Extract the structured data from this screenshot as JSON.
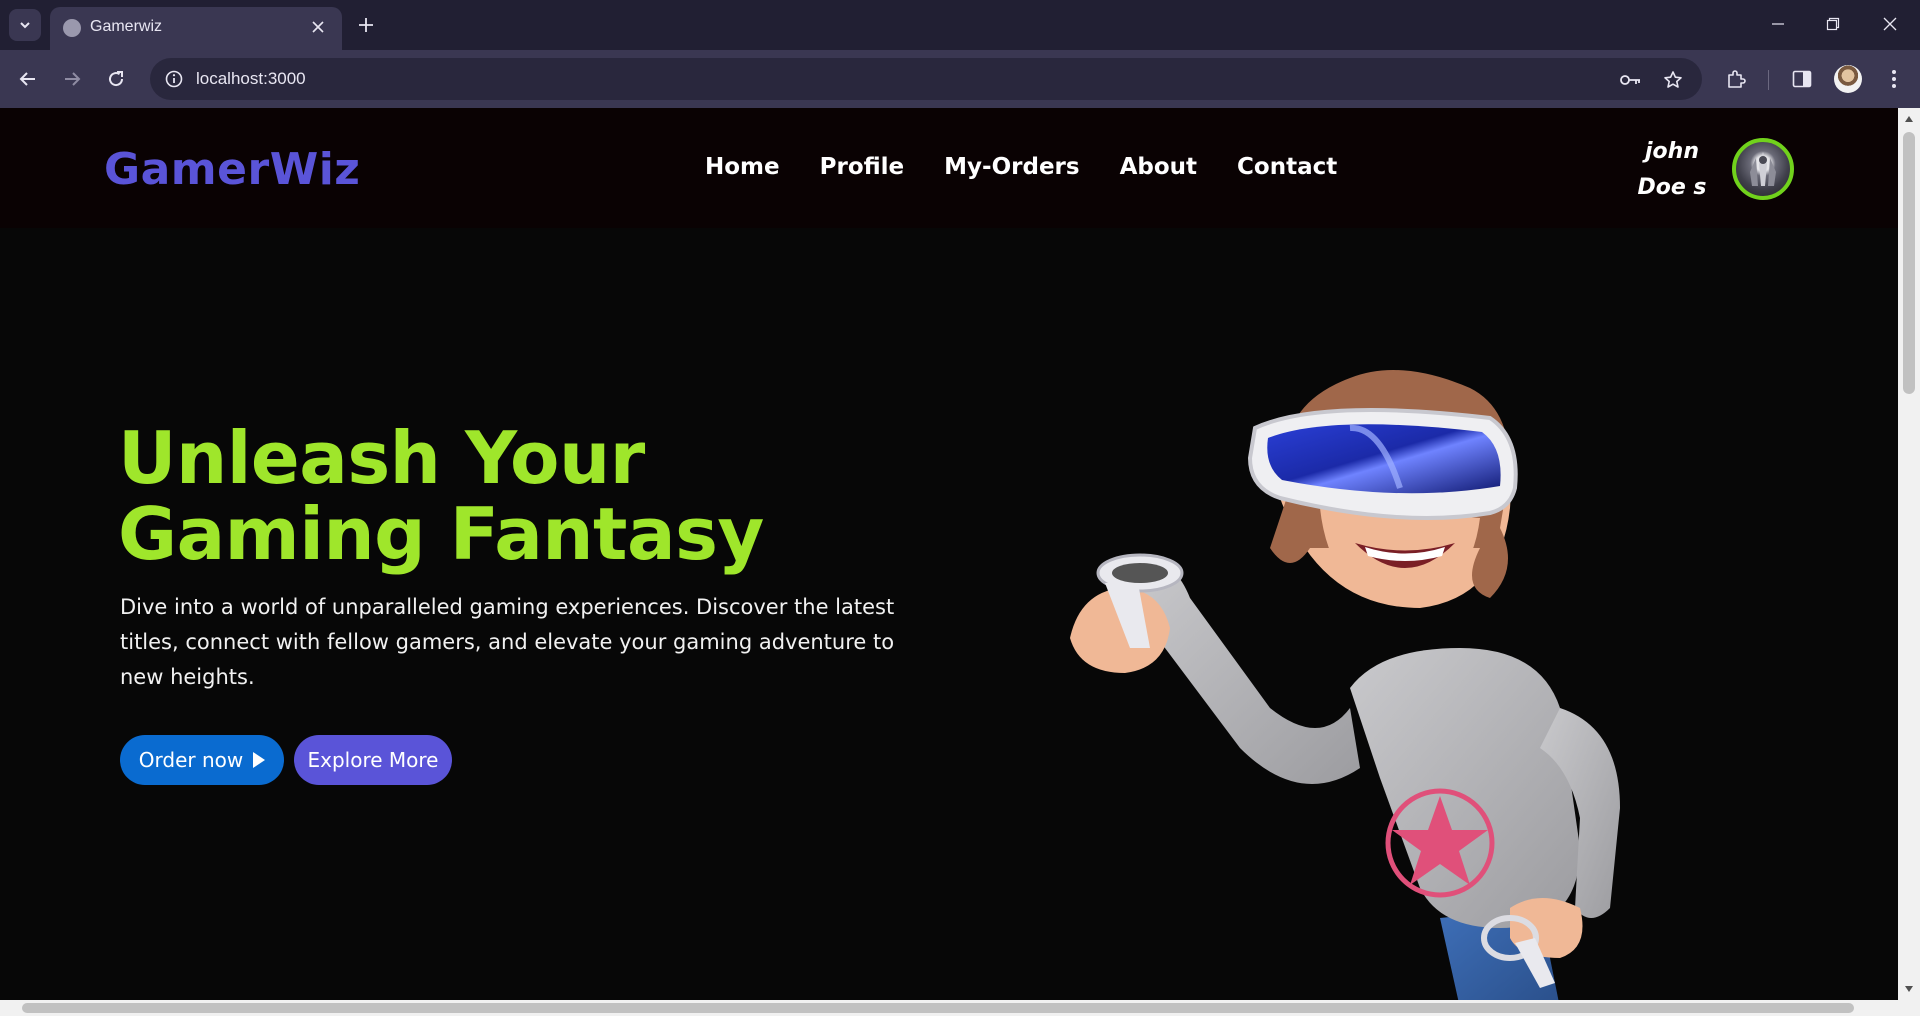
{
  "browser": {
    "tab_title": "Gamerwiz",
    "url": "localhost:3000"
  },
  "site": {
    "brand": "GamerWiz",
    "nav": [
      "Home",
      "Profile",
      "My-Orders",
      "About",
      "Contact"
    ],
    "user": {
      "first": "john",
      "last": "Doe s"
    }
  },
  "hero": {
    "title": "Unleash Your Gaming Fantasy",
    "description": "Dive into a world of unparalleled gaming experiences. Discover the latest titles, connect with fellow gamers, and elevate your gaming adventure to new heights.",
    "order_button": "Order now",
    "explore_button": "Explore More"
  },
  "colors": {
    "brand": "#5a54d8",
    "hero_title": "#9fe62b",
    "order_button": "#0a6bd0",
    "explore_button": "#5a54d8",
    "avatar_ring": "#71d21c"
  }
}
